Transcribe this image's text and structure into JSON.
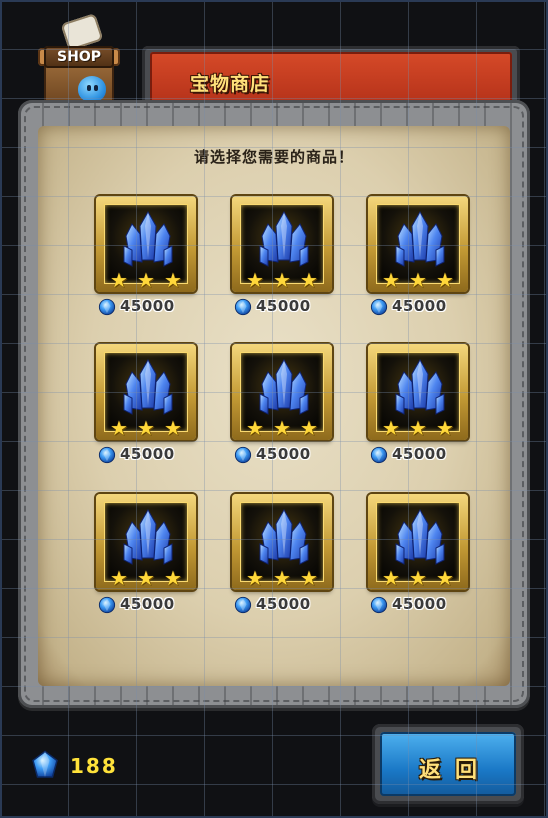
{
  "header": {
    "shop_sign": "SHOP",
    "title": "宝物商店"
  },
  "prompt": "请选择您需要的商品！",
  "items": [
    {
      "icon": "blue-crystal-icon",
      "stars": 3,
      "price": "45000"
    },
    {
      "icon": "blue-crystal-icon",
      "stars": 3,
      "price": "45000"
    },
    {
      "icon": "blue-crystal-icon",
      "stars": 3,
      "price": "45000"
    },
    {
      "icon": "blue-crystal-icon",
      "stars": 3,
      "price": "45000"
    },
    {
      "icon": "blue-crystal-icon",
      "stars": 3,
      "price": "45000"
    },
    {
      "icon": "blue-crystal-icon",
      "stars": 3,
      "price": "45000"
    },
    {
      "icon": "blue-crystal-icon",
      "stars": 3,
      "price": "45000"
    },
    {
      "icon": "blue-crystal-icon",
      "stars": 3,
      "price": "45000"
    },
    {
      "icon": "blue-crystal-icon",
      "stars": 3,
      "price": "45000"
    }
  ],
  "player": {
    "gems": "188"
  },
  "buttons": {
    "back": "返回"
  },
  "colors": {
    "title_bar": "#c83b1f",
    "title_text": "#ffe07a",
    "back_button": "#1a78c6",
    "gold_frame": "#c39a35",
    "currency_text": "#ffe23a"
  }
}
